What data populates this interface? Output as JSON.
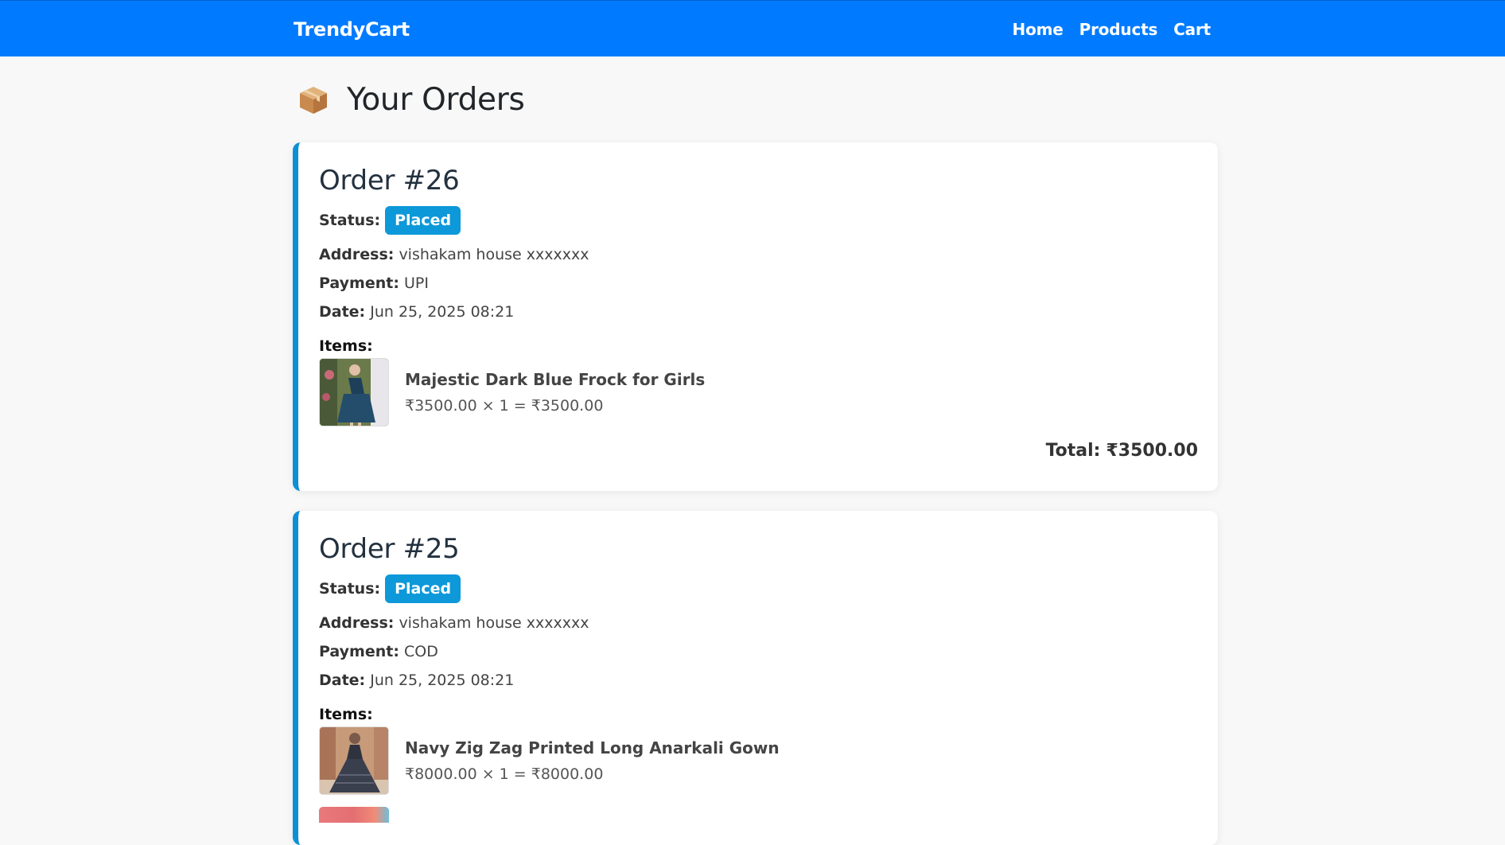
{
  "navbar": {
    "brand": "TrendyCart",
    "links": [
      "Home",
      "Products",
      "Cart"
    ]
  },
  "page": {
    "title": "Your Orders",
    "title_icon": "package-icon"
  },
  "orders": [
    {
      "title": "Order #26",
      "status_label": "Status:",
      "status": "Placed",
      "address_label": "Address:",
      "address": "vishakam house xxxxxxx",
      "payment_label": "Payment:",
      "payment": "UPI",
      "date_label": "Date:",
      "date": "Jun 25, 2025 08:21",
      "items_label": "Items:",
      "items": [
        {
          "name": "Majestic Dark Blue Frock for Girls",
          "price_line": "₹3500.00 × 1 = ₹3500.00"
        }
      ],
      "total_label": "Total:",
      "total": "₹3500.00"
    },
    {
      "title": "Order #25",
      "status_label": "Status:",
      "status": "Placed",
      "address_label": "Address:",
      "address": "vishakam house xxxxxxx",
      "payment_label": "Payment:",
      "payment": "COD",
      "date_label": "Date:",
      "date": "Jun 25, 2025 08:21",
      "items_label": "Items:",
      "items": [
        {
          "name": "Navy Zig Zag Printed Long Anarkali Gown",
          "price_line": "₹8000.00 × 1 = ₹8000.00"
        }
      ]
    }
  ],
  "colors": {
    "navbar": "#007bff",
    "card_accent": "#0d8fd6",
    "badge": "#0d98d9"
  }
}
